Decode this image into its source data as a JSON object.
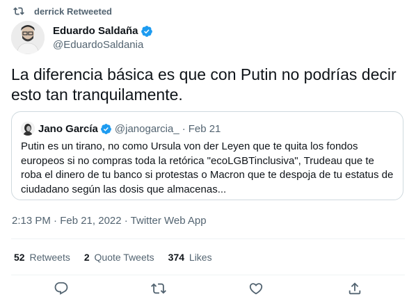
{
  "retweet_banner": {
    "text": "derrick Retweeted",
    "icon": "retweet-icon"
  },
  "author": {
    "name": "Eduardo Saldaña",
    "handle": "@EduardoSaldania",
    "verified": true
  },
  "tweet": {
    "text": "La diferencia básica es que con Putin no podrías decir esto tan tranquilamente."
  },
  "quoted_tweet": {
    "name": "Jano García",
    "handle": "@janogarcia_",
    "separator": "·",
    "date": "Feb 21",
    "verified": true,
    "text": "Putin es un tirano, no como Ursula von der Leyen que te quita los fondos europeos si no compras toda la retórica \"ecoLGBTinclusiva\", Trudeau que te roba el dinero de tu banco si protestas o Macron que te despoja de tu estatus de ciudadano según las dosis que almacenas..."
  },
  "meta": {
    "timestamp": "2:13 PM · Feb 21, 2022 · Twitter Web App"
  },
  "stats": {
    "retweets_count": "52",
    "retweets_label": "Retweets",
    "quotes_count": "2",
    "quotes_label": "Quote Tweets",
    "likes_count": "374",
    "likes_label": "Likes"
  },
  "actions": [
    "reply-icon",
    "retweet-icon",
    "like-icon",
    "share-icon"
  ],
  "colors": {
    "verified": "#1d9bf0",
    "secondary_text": "#536471",
    "border": "#cfd9de"
  }
}
